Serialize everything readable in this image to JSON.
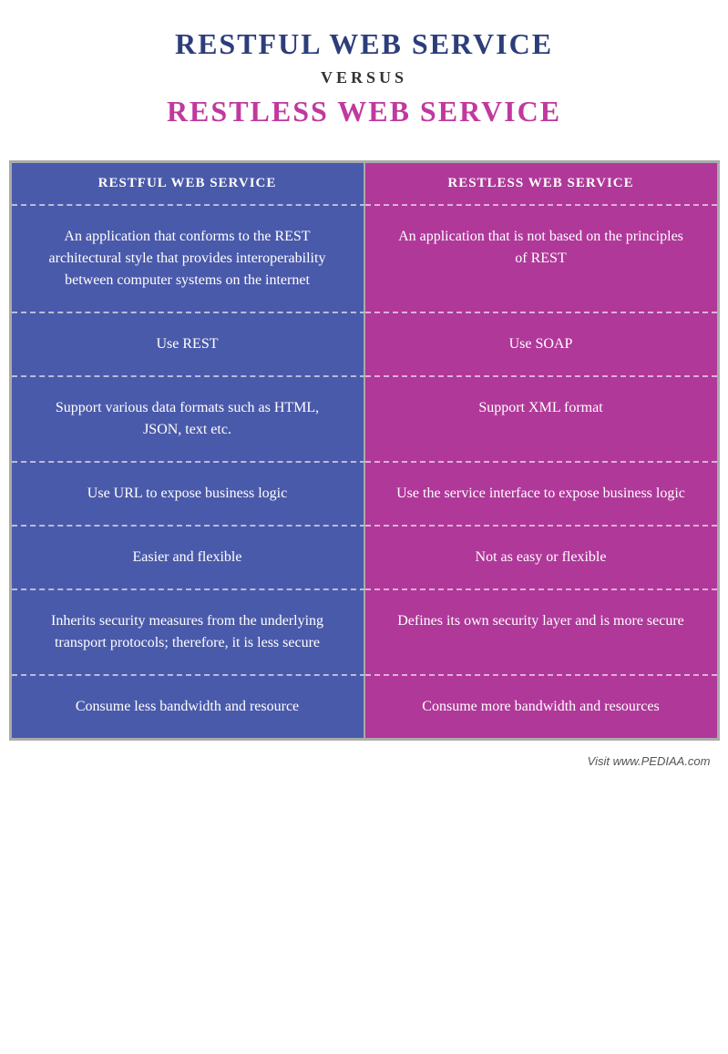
{
  "header": {
    "title1": "RESTFUL WEB SERVICE",
    "versus": "VERSUS",
    "title2": "RESTLESS WEB SERVICE"
  },
  "table": {
    "col1_header": "RESTFUL WEB SERVICE",
    "col2_header": "RESTLESS WEB SERVICE",
    "rows": [
      {
        "left": "An application that conforms to the REST architectural style that provides interoperability between computer systems on the internet",
        "right": "An application that is not based on the principles of REST"
      },
      {
        "left": "Use REST",
        "right": "Use SOAP"
      },
      {
        "left": "Support various data formats such as HTML, JSON, text etc.",
        "right": "Support XML format"
      },
      {
        "left": "Use URL to expose business logic",
        "right": "Use the service interface to expose business logic"
      },
      {
        "left": "Easier and flexible",
        "right": "Not as easy or flexible"
      },
      {
        "left": "Inherits security measures from the underlying transport protocols; therefore, it is less secure",
        "right": "Defines its own security layer and is more secure"
      },
      {
        "left": "Consume less bandwidth and resource",
        "right": "Consume more bandwidth and resources"
      }
    ]
  },
  "footer": {
    "credit": "Visit www.PEDIAA.com"
  }
}
